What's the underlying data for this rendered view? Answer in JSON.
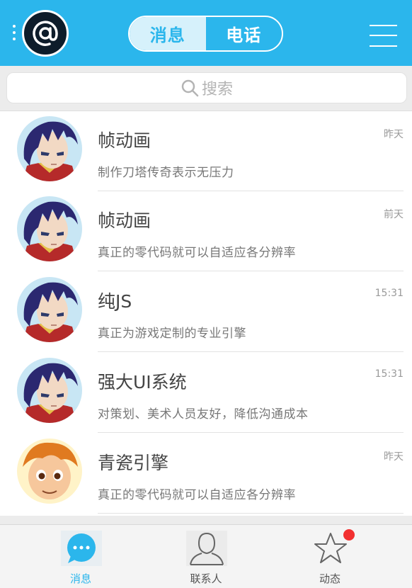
{
  "header": {
    "tabs": [
      {
        "label": "消息",
        "active": true
      },
      {
        "label": "电话",
        "active": false
      }
    ],
    "icons": {
      "left": "vertical-dots-icon",
      "avatar": "at-sign-avatar",
      "right": "hamburger-menu-icon"
    }
  },
  "search": {
    "placeholder": "搜索"
  },
  "conversations": [
    {
      "name": "帧动画",
      "message": "制作刀塔传奇表示无压力",
      "time": "昨天",
      "avatar": "anime-boy-purple-hair"
    },
    {
      "name": "帧动画",
      "message": "真正的零代码就可以自适应各分辨率",
      "time": "前天",
      "avatar": "anime-boy-purple-hair"
    },
    {
      "name": "纯JS",
      "message": "真正为游戏定制的专业引擎",
      "time": "15:31",
      "avatar": "anime-boy-purple-hair"
    },
    {
      "name": "强大UI系统",
      "message": "对策划、美术人员友好，降低沟通成本",
      "time": "15:31",
      "avatar": "anime-boy-purple-hair"
    },
    {
      "name": "青瓷引擎",
      "message": "真正的零代码就可以自适应各分辨率",
      "time": "昨天",
      "avatar": "cartoon-boy-orange-hair"
    }
  ],
  "tabbar": [
    {
      "label": "消息",
      "icon": "chat-bubble-icon",
      "active": true
    },
    {
      "label": "联系人",
      "icon": "person-icon",
      "active": false
    },
    {
      "label": "动态",
      "icon": "star-icon",
      "active": false,
      "badge": true
    }
  ],
  "colors": {
    "accent": "#2bb6ec",
    "badge": "#f23030"
  }
}
